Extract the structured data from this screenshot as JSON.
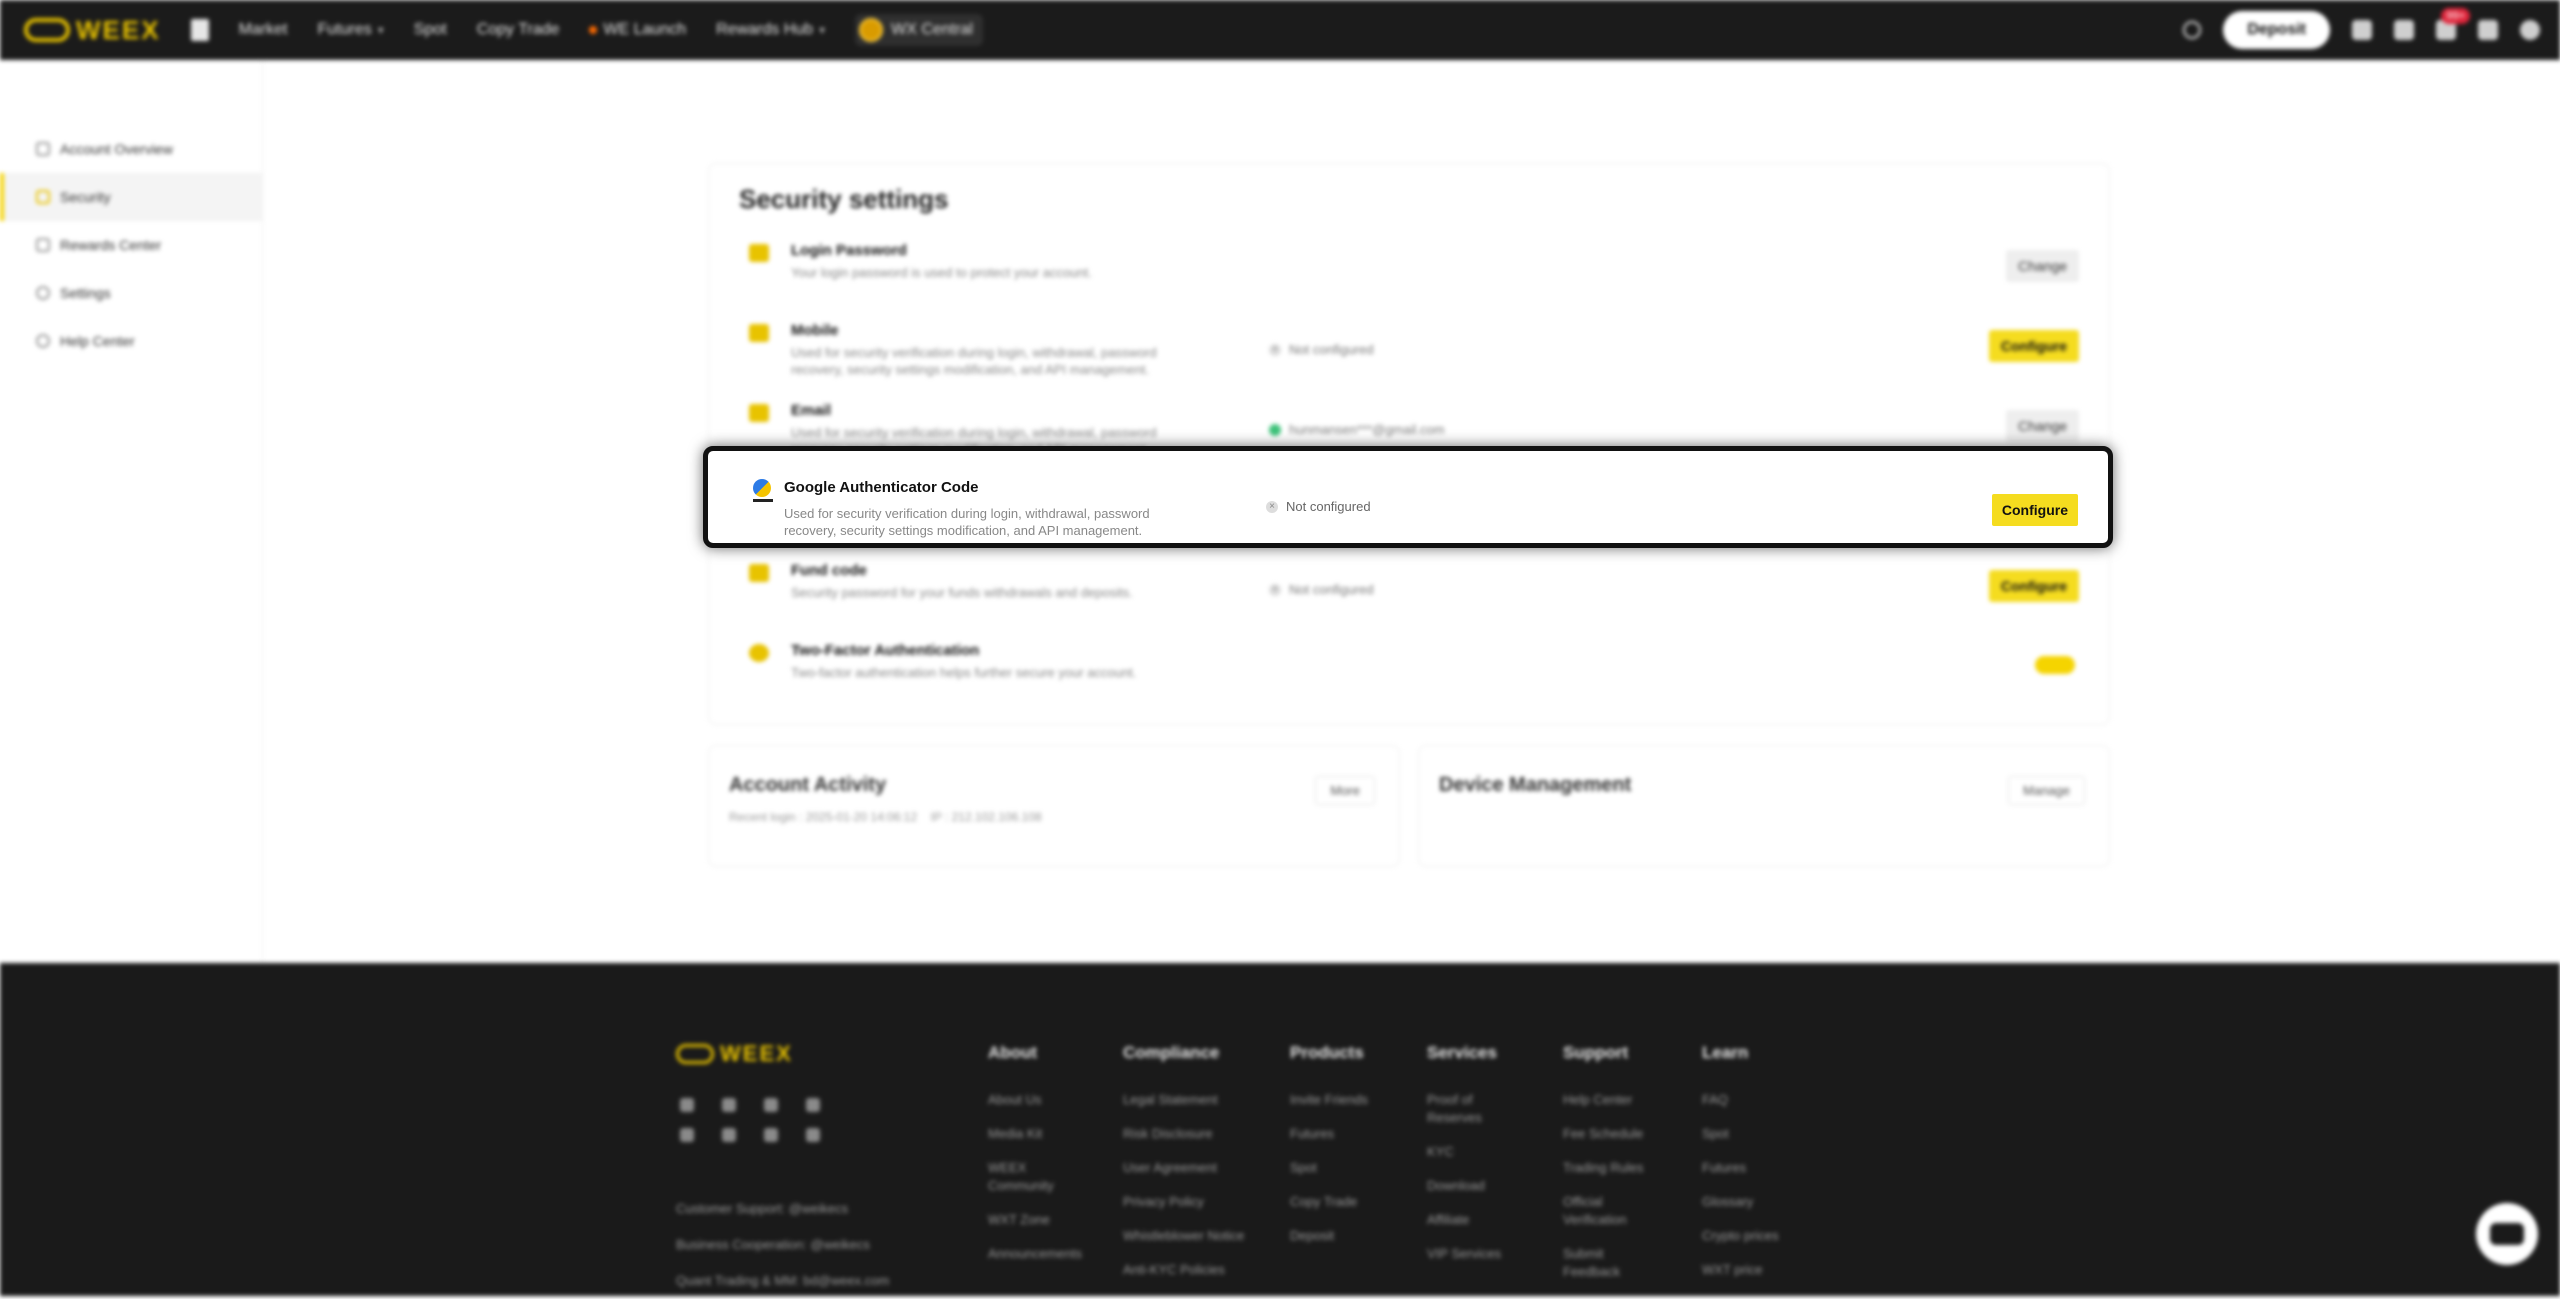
{
  "nav": {
    "logo": "WEEX",
    "items": [
      "Market",
      "Futures",
      "Spot",
      "Copy Trade",
      "WE Launch",
      "Rewards Hub"
    ],
    "wx_central": "WX Central",
    "deposit": "Deposit",
    "notif_badge": "99+"
  },
  "sidebar": {
    "items": [
      "Account Overview",
      "Security",
      "Rewards Center",
      "Settings",
      "Help Center"
    ]
  },
  "security": {
    "title": "Security settings",
    "rows": [
      {
        "name": "Login Password",
        "desc": "Your login password is used to protect your account.",
        "status": "",
        "button": "Change"
      },
      {
        "name": "Mobile",
        "desc": "Used for security verification during login, withdrawal, password recovery, security settings modification, and API management.",
        "status": "Not configured",
        "button": "Configure"
      },
      {
        "name": "Email",
        "desc": "Used for security verification during login, withdrawal, password recovery, security settings modification, and API management.",
        "status": "hunmansen***@gmail.com",
        "button": "Change"
      },
      {
        "name": "Google Authenticator Code",
        "desc": "Used for security verification during login, withdrawal, password recovery, security settings modification, and API management.",
        "status": "Not configured",
        "button": "Configure"
      },
      {
        "name": "Fund code",
        "desc": "Security password for your funds withdrawals and deposits.",
        "status": "Not configured",
        "button": "Configure"
      },
      {
        "name": "Two-Factor Authentication",
        "desc": "Two-factor authentication helps further secure your account.",
        "status": "",
        "button": ""
      }
    ]
  },
  "activity": {
    "title": "Account Activity",
    "recent": "Recent login : 2025-01-20 14:06:12",
    "ip": "IP : 212.102.106.108",
    "button": "More"
  },
  "devices": {
    "title": "Device Management",
    "button": "Manage"
  },
  "footer": {
    "logo": "WEEX",
    "contact": [
      "Customer Support: @weikecs",
      "Business Cooperation: @weikecs",
      "Quant Trading & MM: bd@weex.com"
    ],
    "columns": [
      {
        "title": "About",
        "links": [
          "About Us",
          "Media Kit",
          "WEEX Community",
          "WXT Zone",
          "Announcements"
        ]
      },
      {
        "title": "Compliance",
        "links": [
          "Legal Statement",
          "Risk Disclosure",
          "User Agreement",
          "Privacy Policy",
          "Whistleblower Notice",
          "Anti-KYC Policies"
        ]
      },
      {
        "title": "Products",
        "links": [
          "Invite Friends",
          "Futures",
          "Spot",
          "Copy Trade",
          "Deposit"
        ]
      },
      {
        "title": "Services",
        "links": [
          "Proof of Reserves",
          "KYC",
          "Download",
          "Affiliate",
          "VIP Services"
        ]
      },
      {
        "title": "Support",
        "links": [
          "Help Center",
          "Fee Schedule",
          "Trading Rules",
          "Official Verification",
          "Submit Feedback"
        ]
      },
      {
        "title": "Learn",
        "links": [
          "FAQ",
          "Spot",
          "Futures",
          "Glossary",
          "Crypto prices",
          "WXT price"
        ]
      }
    ]
  },
  "colors": {
    "accent": "#f5dc1f",
    "dark": "#1b1b1b"
  }
}
